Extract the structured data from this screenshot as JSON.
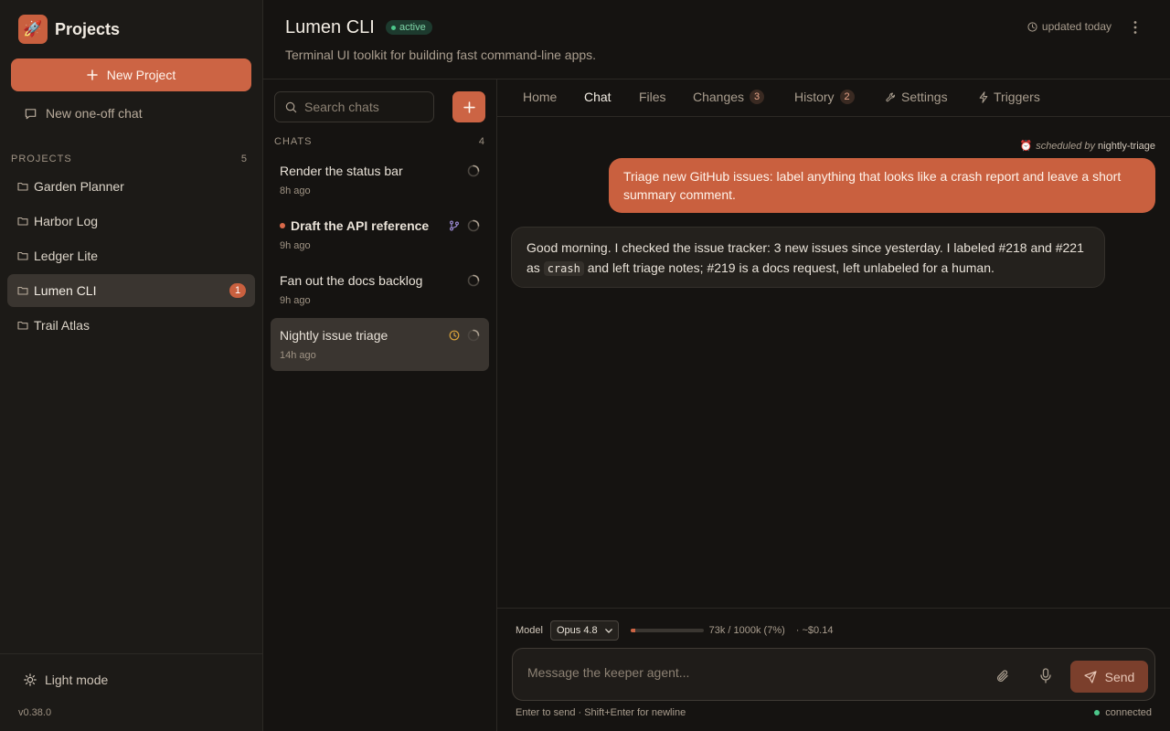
{
  "sidebar": {
    "brand": "Projects",
    "new_project": "New Project",
    "one_off_chat": "New one-off chat",
    "projects_heading": "PROJECTS",
    "projects_count": "5",
    "projects": [
      {
        "name": "Garden Planner"
      },
      {
        "name": "Harbor Log"
      },
      {
        "name": "Ledger Lite"
      },
      {
        "name": "Lumen CLI",
        "badge": "1"
      },
      {
        "name": "Trail Atlas"
      }
    ],
    "light_mode": "Light mode",
    "version": "v0.38.0"
  },
  "header": {
    "title": "Lumen CLI",
    "status": "active",
    "description": "Terminal UI toolkit for building fast command-line apps.",
    "updated": "updated today"
  },
  "chat_list": {
    "search_placeholder": "Search chats",
    "heading": "CHATS",
    "count": "4",
    "items": [
      {
        "title": "Render the status bar",
        "time": "8h ago"
      },
      {
        "title": "Draft the API reference",
        "time": "9h ago"
      },
      {
        "title": "Fan out the docs backlog",
        "time": "9h ago"
      },
      {
        "title": "Nightly issue triage",
        "time": "14h ago"
      }
    ]
  },
  "tabs": [
    {
      "label": "Home"
    },
    {
      "label": "Chat"
    },
    {
      "label": "Files"
    },
    {
      "label": "Changes",
      "count": "3"
    },
    {
      "label": "History",
      "count": "2"
    },
    {
      "label": "Settings"
    },
    {
      "label": "Triggers"
    }
  ],
  "conversation": {
    "scheduled_label": "scheduled by",
    "scheduled_by": "nightly-triage",
    "user_message": "Triage new GitHub issues: label anything that looks like a crash report and leave a short summary comment.",
    "agent_part1": "Good morning. I checked the issue tracker: 3 new issues since yesterday. I labeled #218 and #221 as ",
    "agent_code": "crash",
    "agent_part2": " and left triage notes; #219 is a docs request, left unlabeled for a human."
  },
  "composer": {
    "model_label": "Model",
    "model_value": "Opus 4.8",
    "context_fraction": 0.07,
    "context_text": "73k / 1000k (7%)",
    "cost": "· ~$0.14",
    "placeholder": "Message the keeper agent...",
    "send": "Send",
    "hint": "Enter to send · Shift+Enter for newline",
    "connection": "connected"
  },
  "colors": {
    "accent": "#cc6444",
    "status_green": "#4cc68a",
    "clock_yellow": "#d9a23a",
    "branch_purple": "#9d8cd6"
  }
}
